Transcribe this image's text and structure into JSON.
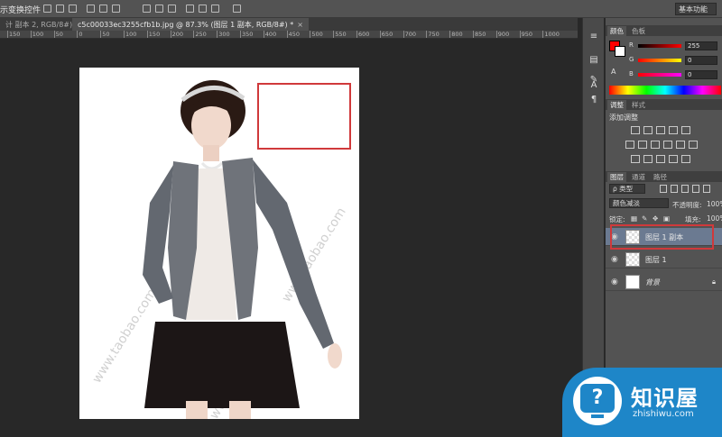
{
  "options_bar": {
    "show_transform_label": "示变换控件",
    "workspace": "基本功能"
  },
  "tabs": [
    {
      "label": "计 副本 2, RGB/8#) *",
      "close": "×"
    },
    {
      "label": "c5c00033ec3255cfb1b.jpg @ 87.3% (图层 1 副本, RGB/8#) *",
      "close": "×"
    }
  ],
  "ruler": {
    "ticks": [
      "150",
      "100",
      "50",
      "0",
      "50",
      "100",
      "150",
      "200",
      "250",
      "300",
      "350",
      "400",
      "450",
      "500",
      "550",
      "600",
      "650",
      "700",
      "750",
      "800",
      "850",
      "900",
      "950",
      "1000"
    ]
  },
  "canvas": {
    "zoom": "87.3%",
    "watermark": "www.taobao.com"
  },
  "panels": {
    "color": {
      "tabs": [
        "颜色",
        "色板"
      ],
      "channels": [
        {
          "label": "R",
          "value": "255",
          "color": "#ff0000"
        },
        {
          "label": "G",
          "value": "0",
          "color": "#00ff00"
        },
        {
          "label": "B",
          "value": "0",
          "color": "#0000ff"
        }
      ],
      "foreground": "#ff0000",
      "background": "#ffffff"
    },
    "adjustments": {
      "tabs": [
        "调整",
        "样式"
      ],
      "title": "添加调整"
    },
    "layers": {
      "tabs": [
        "图层",
        "通道",
        "路径"
      ],
      "filter": "ρ 类型",
      "blend_mode": "颜色减淡",
      "opacity_label": "不透明度:",
      "opacity_value": "100%",
      "lock_label": "锁定:",
      "fill_label": "填充:",
      "fill_value": "100%",
      "items": [
        {
          "name": "图层 1 副本",
          "selected": true
        },
        {
          "name": "图层 1",
          "selected": false
        },
        {
          "name": "背景",
          "selected": false
        }
      ]
    }
  },
  "logo": {
    "brand": "知识屋",
    "domain": "zhishiwu.com",
    "icon_glyph": "?"
  }
}
